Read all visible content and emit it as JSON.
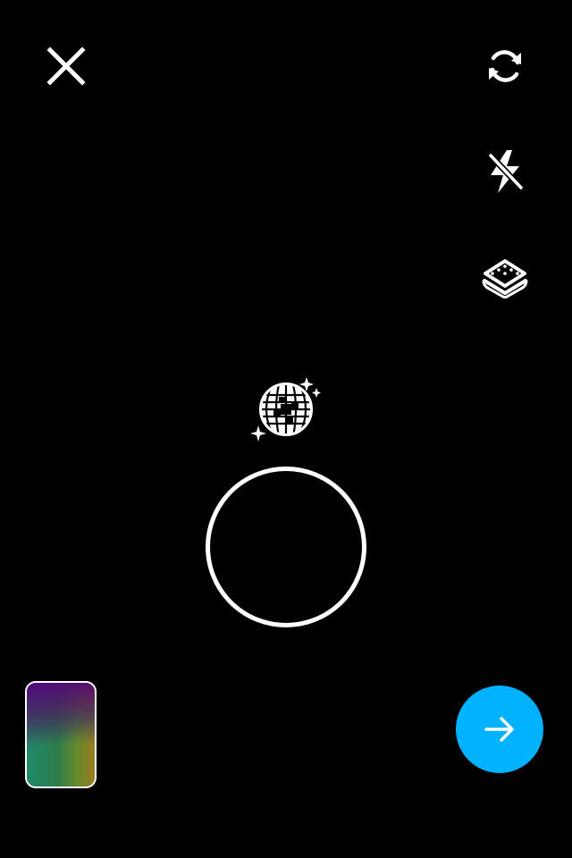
{
  "app": {
    "screen": "camera-capture"
  },
  "top_bar": {
    "close_icon": "close-icon",
    "flip_camera_icon": "flip-camera-icon"
  },
  "side_controls": {
    "flash_icon": "flash-off-icon",
    "flash_state": "off",
    "layers_icon": "layers-icon"
  },
  "effects": {
    "effect_icon": "disco-ball-icon"
  },
  "capture": {
    "shutter_icon": "shutter-ring"
  },
  "bottom_bar": {
    "gallery_icon": "gallery-thumbnail",
    "next_icon": "arrow-right-icon"
  },
  "colors": {
    "background": "#000000",
    "foreground": "#ffffff",
    "accent": "#00b2ff"
  }
}
